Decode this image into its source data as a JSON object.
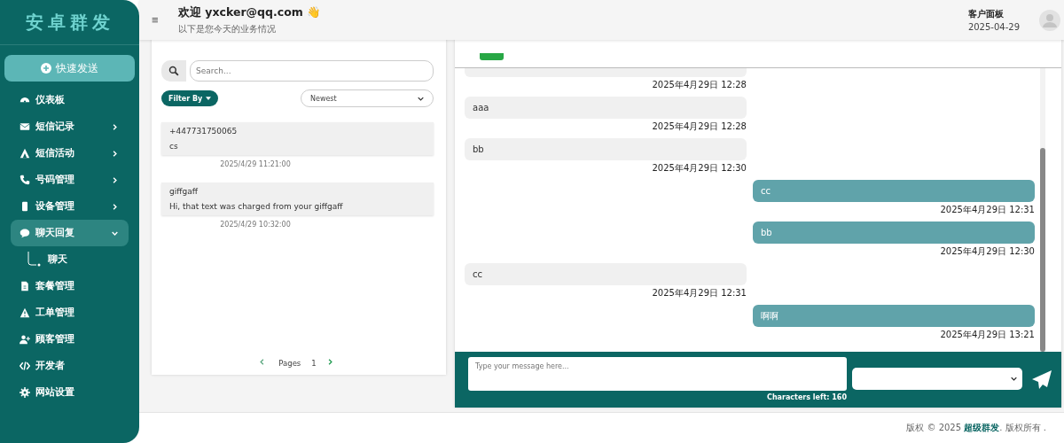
{
  "sidebar": {
    "logo": "安卓群发",
    "quick_button": "快速发送",
    "items": [
      {
        "kind": "link",
        "label": "仪表板",
        "selected": false
      },
      {
        "kind": "group",
        "label": "短信记录",
        "expanded": false,
        "selected": false
      },
      {
        "kind": "group",
        "label": "短信活动",
        "expanded": false,
        "selected": false
      },
      {
        "kind": "group",
        "label": "号码管理",
        "expanded": false,
        "selected": false
      },
      {
        "kind": "group",
        "label": "设备管理",
        "expanded": false,
        "selected": false
      },
      {
        "kind": "group",
        "label": "聊天回复",
        "expanded": true,
        "selected": true,
        "children": [
          {
            "label": "聊天"
          }
        ]
      },
      {
        "kind": "link",
        "label": "套餐管理",
        "selected": false
      },
      {
        "kind": "link",
        "label": "工单管理",
        "selected": false
      },
      {
        "kind": "link",
        "label": "顾客管理",
        "selected": false
      },
      {
        "kind": "link",
        "label": "开发者",
        "selected": false
      },
      {
        "kind": "link",
        "label": "网站设置",
        "selected": false
      }
    ]
  },
  "header": {
    "menu_glyph": "≡",
    "welcome": "欢迎 yxcker@qq.com",
    "wave": "👋",
    "subtitle": "以下是您今天的业务情况",
    "panel_label": "客户面板",
    "date": "2025-04-29"
  },
  "inbox": {
    "search": {
      "placeholder": "Search..."
    },
    "filter_button": "Filter By",
    "sort": "Newest",
    "conversations": [
      {
        "sender": "+447731750065",
        "preview": "cs",
        "time": "2025/4/29 11:21:00"
      },
      {
        "sender": "giffgaff",
        "preview": "Hi, that text was charged from your giffgaff",
        "time": "2025/4/29 10:32:00"
      }
    ],
    "pager": {
      "label": "Pages",
      "page": "1"
    }
  },
  "chat": {
    "messages": [
      {
        "kind": "cut",
        "time": "2025年4月29日 12:28"
      },
      {
        "kind": "incoming",
        "text": "aaa",
        "time": "2025年4月29日 12:28"
      },
      {
        "kind": "incoming",
        "text": "bb",
        "time": "2025年4月29日 12:30"
      },
      {
        "kind": "outgoing",
        "text": "cc",
        "time": "2025年4月29日 12:31"
      },
      {
        "kind": "outgoing",
        "text": "bb",
        "time": "2025年4月29日 12:30"
      },
      {
        "kind": "incoming",
        "text": "cc",
        "time": "2025年4月29日 12:31"
      },
      {
        "kind": "outgoing",
        "text": "啊啊",
        "time": "2025年4月29日 13:21"
      }
    ],
    "composer": {
      "placeholder": "Type your message here...",
      "chars_left": "Characters left: 160"
    }
  },
  "footer": {
    "prefix": "版权 © 2025 ",
    "brand": "超级群发",
    "suffix": ". 版权所有 ."
  }
}
